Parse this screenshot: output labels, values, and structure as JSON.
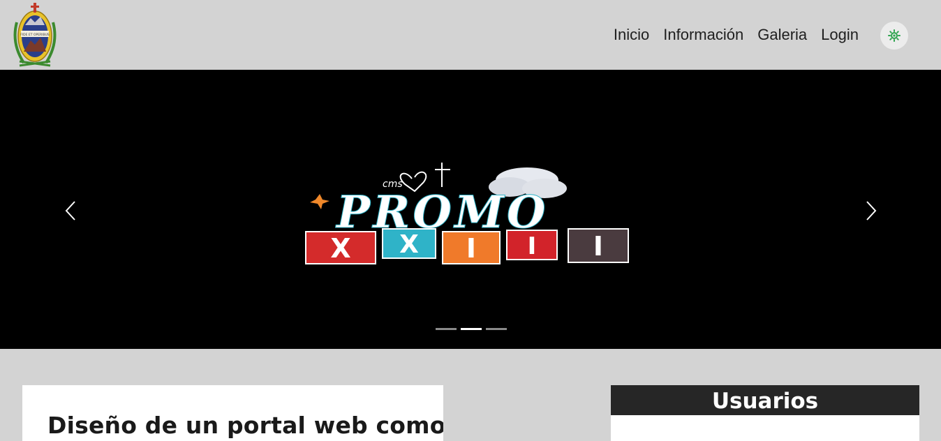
{
  "nav": {
    "links": [
      "Inicio",
      "Información",
      "Galeria",
      "Login"
    ],
    "logo_motto": "FIDE ET OPERIBUS",
    "theme_toggle_icon": "sun-gear-icon",
    "accent_color": "#2ea44f"
  },
  "carousel": {
    "slide_text_small": "cms",
    "slide_text_main": "PROMO",
    "slide_tiles": [
      "X",
      "X",
      "I",
      "I",
      "I"
    ],
    "tile_colors": [
      "#d42b2b",
      "#2fb3c8",
      "#f07a2a",
      "#d2232a",
      "#4a3b3f"
    ],
    "slide_count": 3,
    "active_slide": 2,
    "prev_icon": "chevron-left-icon",
    "next_icon": "chevron-right-icon"
  },
  "article": {
    "title": "Diseño de un portal web como"
  },
  "users": {
    "title": "Usuarios"
  }
}
